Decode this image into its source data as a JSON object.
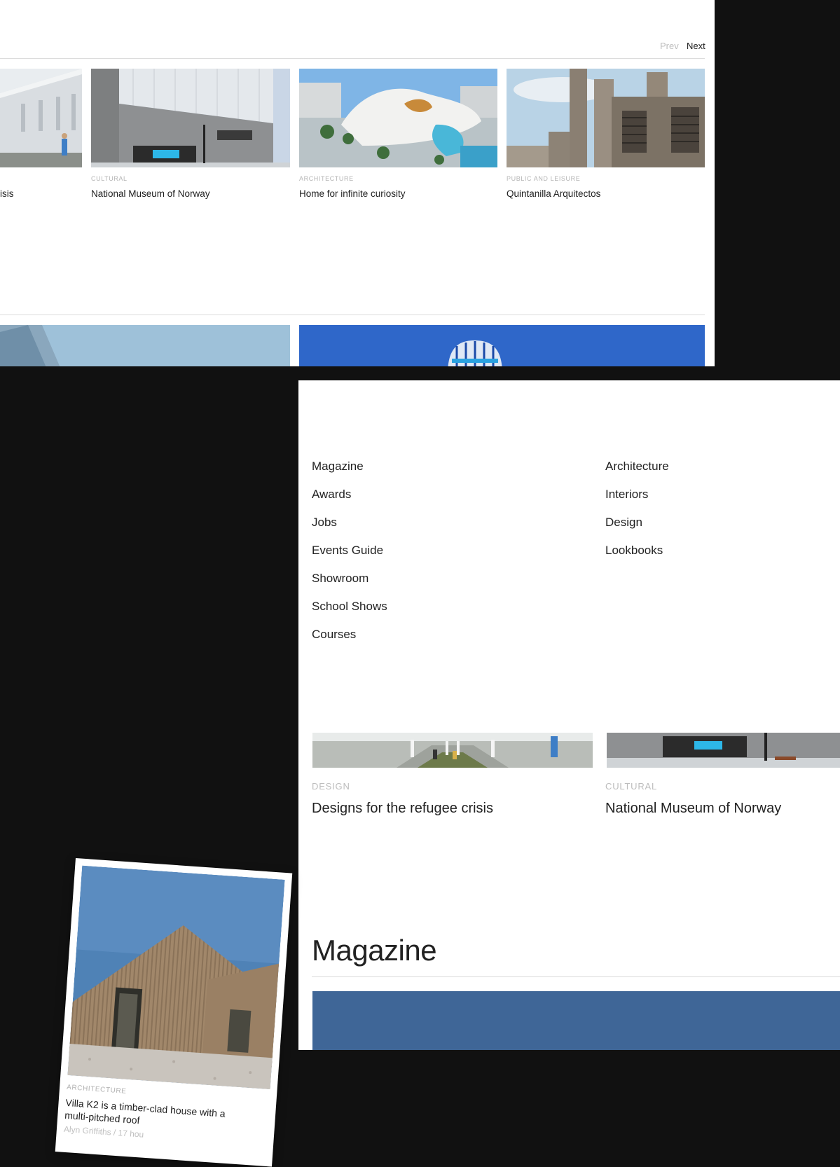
{
  "carousel": {
    "prev_label": "Prev",
    "next_label": "Next",
    "cards": [
      {
        "category": "",
        "title": "isis"
      },
      {
        "category": "CULTURAL",
        "title": "National Museum of Norway"
      },
      {
        "category": "ARCHITECTURE",
        "title": "Home for infinite curiosity"
      },
      {
        "category": "PUBLIC AND LEISURE",
        "title": "Quintanilla Arquitectos"
      }
    ]
  },
  "menu": {
    "col1": [
      "Magazine",
      "Awards",
      "Jobs",
      "Events Guide",
      "Showroom",
      "School Shows",
      "Courses"
    ],
    "col2": [
      "Architecture",
      "Interiors",
      "Design",
      "Lookbooks"
    ]
  },
  "featured": [
    {
      "category": "DESIGN",
      "title": "Designs for the refugee crisis"
    },
    {
      "category": "CULTURAL",
      "title": "National Museum of Norway"
    }
  ],
  "magazine_heading": "Magazine",
  "tilted_card": {
    "category": "ARCHITECTURE",
    "title": "Villa K2 is a timber-clad house with a multi-pitched roof",
    "meta": "Alyn Griffiths  /  17 hou"
  },
  "colors": {
    "background": "#111111",
    "panel": "#ffffff",
    "muted_text": "#bdbdbd",
    "sky_blue": "#2f67c9"
  }
}
